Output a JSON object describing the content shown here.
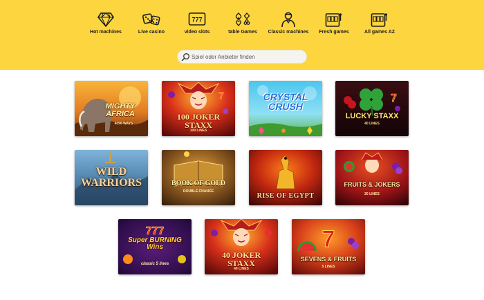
{
  "nav": {
    "items": [
      {
        "label": "Hot machines",
        "icon": "diamond-icon"
      },
      {
        "label": "Live casino",
        "icon": "dice-icon"
      },
      {
        "label": "video slots",
        "icon": "slot-777-icon"
      },
      {
        "label": "table Games",
        "icon": "card-suits-icon"
      },
      {
        "label": "Classic machines",
        "icon": "dealer-icon"
      },
      {
        "label": "Fresh games",
        "icon": "slot-machine-icon"
      },
      {
        "label": "All games AZ",
        "icon": "slot-machine-icon"
      }
    ]
  },
  "search": {
    "placeholder": "Spiel oder Anbieter finden",
    "icon": "search-icon"
  },
  "games": [
    {
      "title": "MIGHTY AFRICA",
      "subtitle": "4096 WAYS"
    },
    {
      "title": "100 JOKER STAXX",
      "subtitle": "100 LINES"
    },
    {
      "title": "CRYSTAL CRUSH",
      "subtitle": ""
    },
    {
      "title": "LUCKY STAXX",
      "subtitle": "40 LINES"
    },
    {
      "title": "WILD WARRIORS",
      "subtitle": ""
    },
    {
      "title": "BOOK OF GOLD",
      "subtitle": "DOUBLE CHANCE"
    },
    {
      "title": "RISE OF EGYPT",
      "subtitle": ""
    },
    {
      "title": "FRUITS & JOKERS",
      "subtitle": "20 LINES"
    },
    {
      "title": "Super BURNING Wins",
      "subtitle": "classic 5 lines"
    },
    {
      "title": "40 JOKER STAXX",
      "subtitle": "40 LINES"
    },
    {
      "title": "SEVENS & FRUITS",
      "subtitle": "5 LINES"
    }
  ],
  "colors": {
    "header_bg": "#fdd53f",
    "search_bg": "#f6f4ef",
    "nav_text": "#1c1c1c",
    "page_bg": "#ffffff"
  }
}
